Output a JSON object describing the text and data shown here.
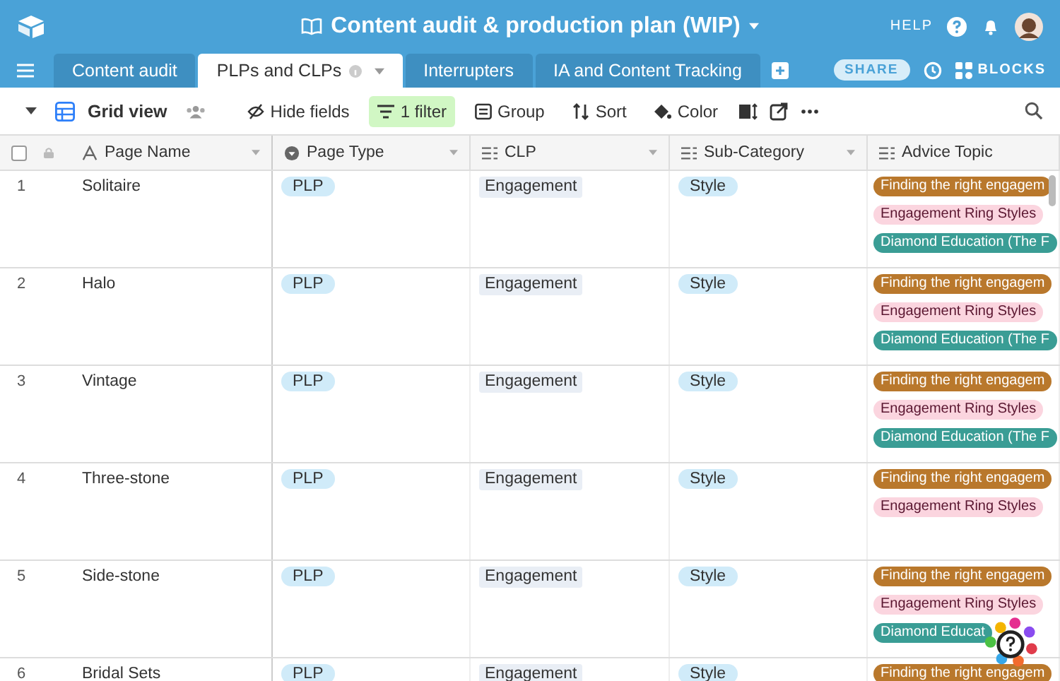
{
  "base": {
    "title": "Content audit & production plan (WIP)",
    "help": "HELP"
  },
  "tabs": [
    {
      "label": "Content audit",
      "selected": false
    },
    {
      "label": "PLPs and CLPs",
      "selected": true
    },
    {
      "label": "Interrupters",
      "selected": false
    },
    {
      "label": "IA and Content Tracking",
      "selected": false
    }
  ],
  "share": "SHARE",
  "blocks": "BLOCKS",
  "view": {
    "name": "Grid view"
  },
  "select_all": {
    "checked": false
  },
  "toolbar": [
    {
      "kind": "hide",
      "label": "Hide fields",
      "active": false
    },
    {
      "kind": "filter",
      "label": "1 filter",
      "active": true
    },
    {
      "kind": "group",
      "label": "Group",
      "active": false
    },
    {
      "kind": "sort",
      "label": "Sort",
      "active": false
    },
    {
      "kind": "color",
      "label": "Color",
      "active": false
    }
  ],
  "columns": [
    "Page Name",
    "Page Type",
    "CLP",
    "Sub-Category",
    "Advice Topic"
  ],
  "rows": [
    {
      "num": "1",
      "name": "Solitaire",
      "type": "PLP",
      "clp": "Engagement",
      "sub": "Style",
      "topics": [
        {
          "label": "Finding the right engagem",
          "color": "#b9782c"
        },
        {
          "label": "Engagement Ring Styles",
          "color": "#fbd5df"
        },
        {
          "label": "Diamond Education (The F",
          "color": "#3a9d95"
        }
      ]
    },
    {
      "num": "2",
      "name": "Halo",
      "type": "PLP",
      "clp": "Engagement",
      "sub": "Style",
      "topics": [
        {
          "label": "Finding the right engagem",
          "color": "#b9782c"
        },
        {
          "label": "Engagement Ring Styles",
          "color": "#fbd5df"
        },
        {
          "label": "Diamond Education (The F",
          "color": "#3a9d95"
        }
      ]
    },
    {
      "num": "3",
      "name": "Vintage",
      "type": "PLP",
      "clp": "Engagement",
      "sub": "Style",
      "topics": [
        {
          "label": "Finding the right engagem",
          "color": "#b9782c"
        },
        {
          "label": "Engagement Ring Styles",
          "color": "#fbd5df"
        },
        {
          "label": "Diamond Education (The F",
          "color": "#3a9d95"
        }
      ]
    },
    {
      "num": "4",
      "name": "Three-stone",
      "type": "PLP",
      "clp": "Engagement",
      "sub": "Style",
      "topics": [
        {
          "label": "Finding the right engagem",
          "color": "#b9782c"
        },
        {
          "label": "Engagement Ring Styles",
          "color": "#fbd5df"
        }
      ]
    },
    {
      "num": "5",
      "name": "Side-stone",
      "type": "PLP",
      "clp": "Engagement",
      "sub": "Style",
      "topics": [
        {
          "label": "Finding the right engagem",
          "color": "#b9782c"
        },
        {
          "label": "Engagement Ring Styles",
          "color": "#fbd5df"
        },
        {
          "label": "Diamond Educat",
          "color": "#3a9d95"
        }
      ]
    },
    {
      "num": "6",
      "name": "Bridal Sets",
      "type": "PLP",
      "clp": "Engagement",
      "sub": "Style",
      "topics": [
        {
          "label": "Finding the right engagem",
          "color": "#b9782c"
        }
      ]
    }
  ]
}
